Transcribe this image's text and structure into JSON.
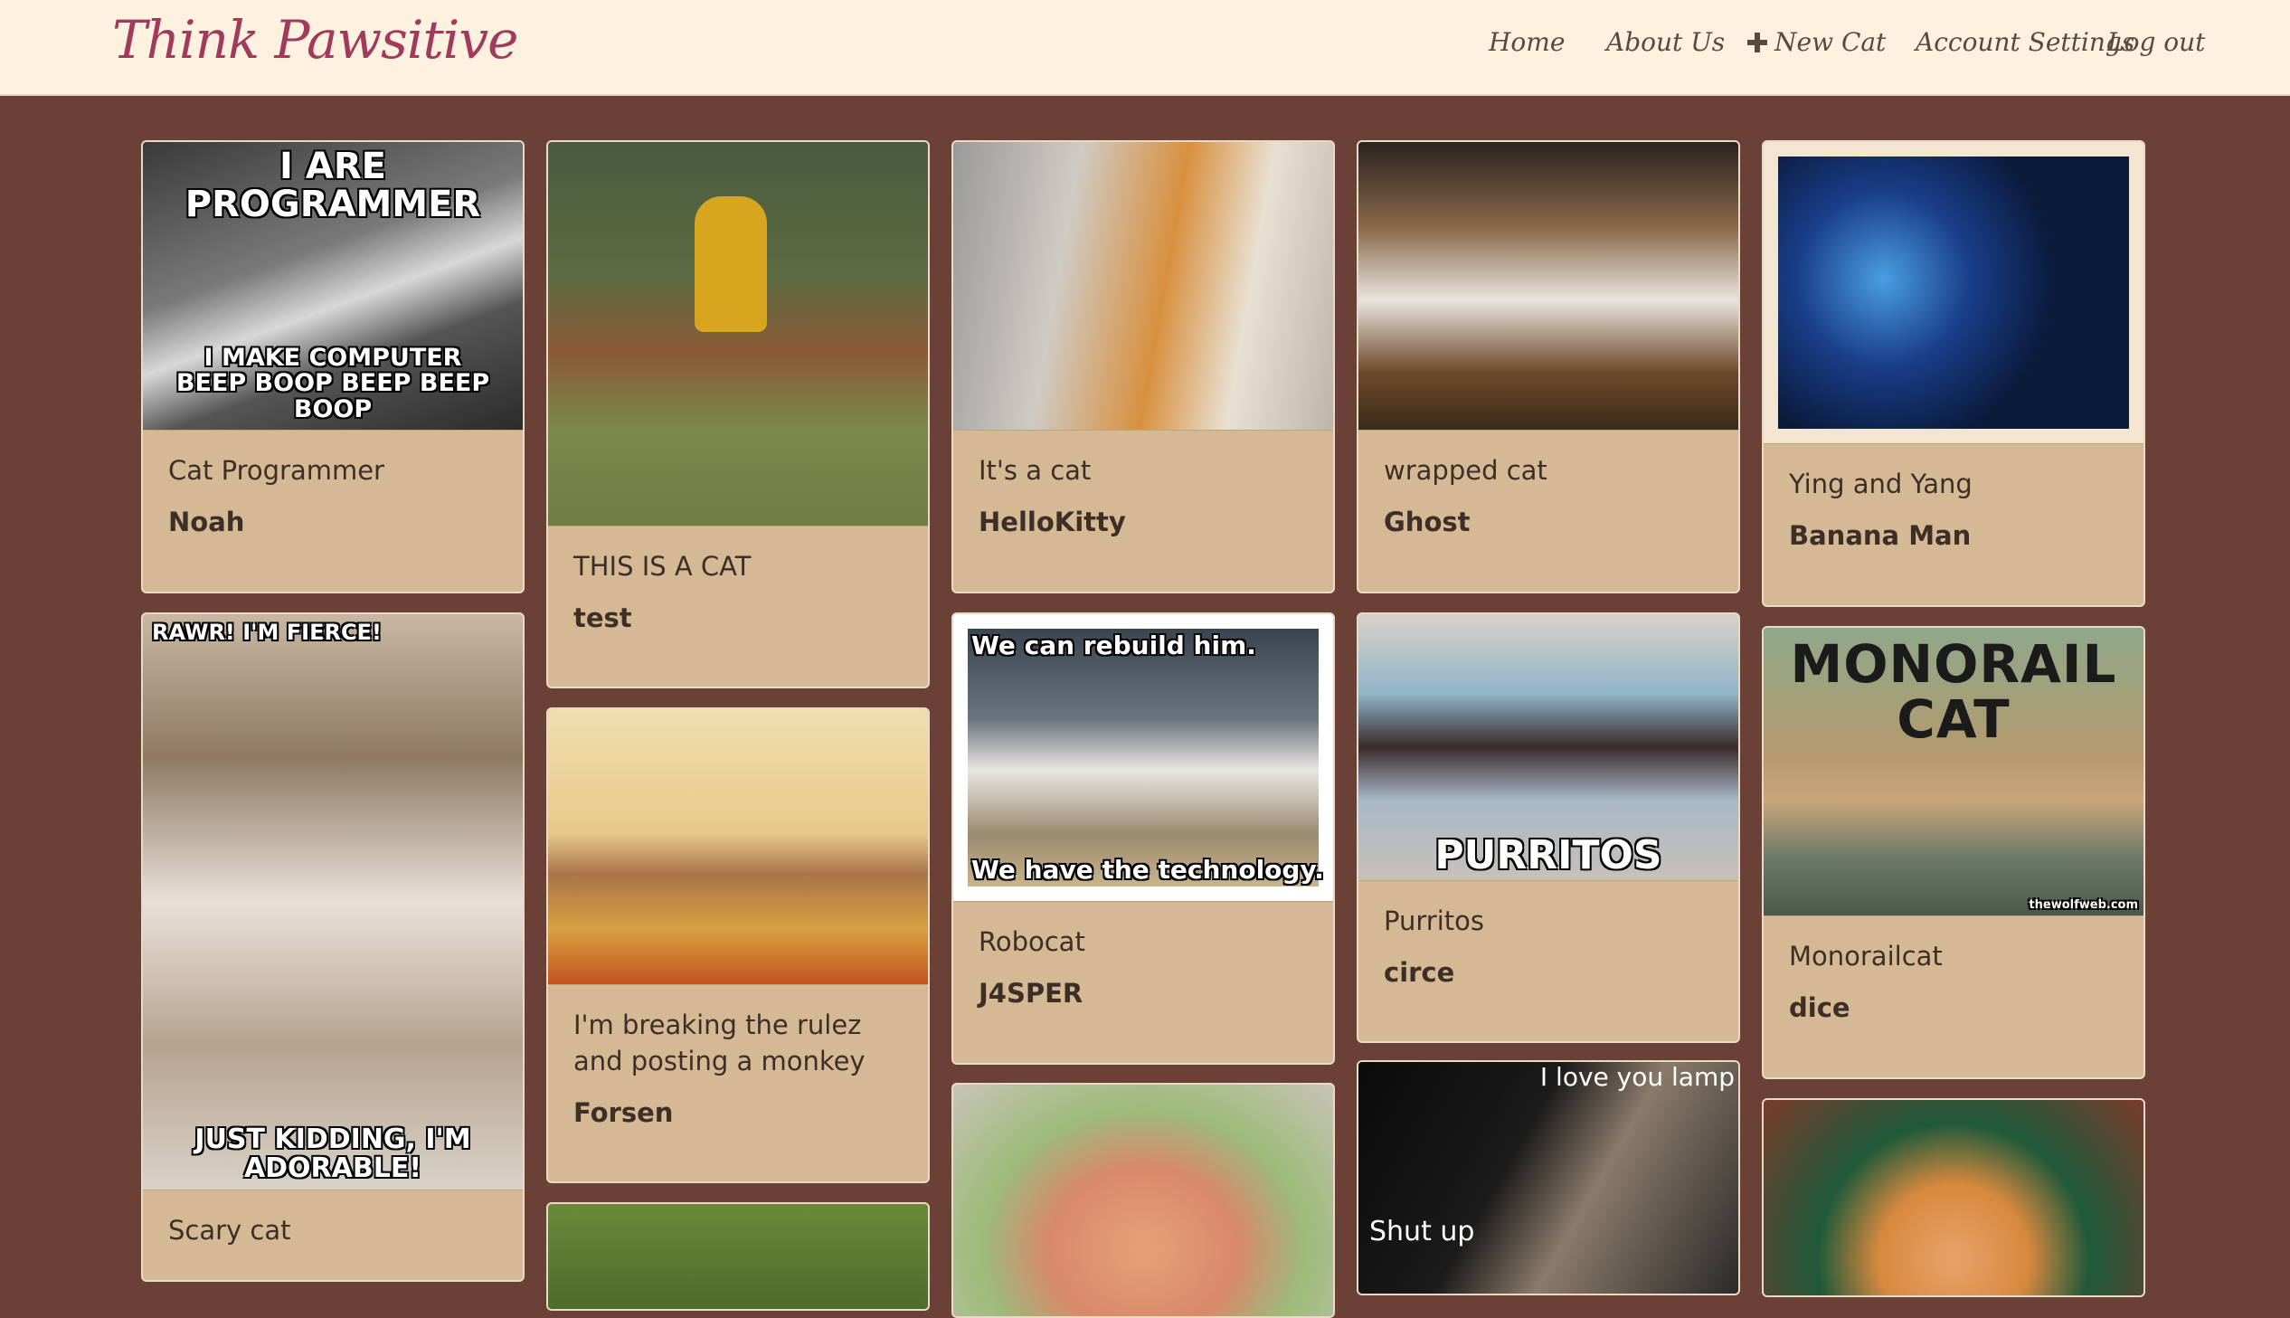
{
  "brand": "Think Pawsitive",
  "nav": {
    "home": "Home",
    "about": "About Us",
    "new_cat": "New Cat",
    "account": "Account Settings",
    "logout": "Log out"
  },
  "posts": {
    "p1": {
      "title": "Cat Programmer",
      "author": "Noah",
      "cap_top": "I ARE PROGRAMMER",
      "cap_bottom": "I MAKE COMPUTER BEEP BOOP BEEP BEEP BOOP"
    },
    "p2": {
      "title": "THIS IS A CAT",
      "author": "test"
    },
    "p3": {
      "title": "It's a cat",
      "author": "HelloKitty"
    },
    "p4": {
      "title": "wrapped cat",
      "author": "Ghost"
    },
    "p5": {
      "title": "Ying and Yang",
      "author": "Banana Man"
    },
    "p6": {
      "title": "Scary cat",
      "cap_top": "RAWR! I'M FIERCE!",
      "cap_bottom": "JUST KIDDING, I'M ADORABLE!"
    },
    "p7": {
      "title": "I'm breaking the rulez and posting a monkey",
      "author": "Forsen"
    },
    "p8": {
      "title": "Robocat",
      "author": "J4SPER",
      "cap_top": "We can rebuild him.",
      "cap_bottom": "We have the technology."
    },
    "p9": {
      "title": "Purritos",
      "author": "circe",
      "cap_bottom": "PURRITOS"
    },
    "p10": {
      "title": "Monorailcat",
      "author": "dice",
      "cap_top": "MONORAIL CAT",
      "credit": "thewolfweb.com"
    },
    "p11": {
      "cap_top": "I love you lamp",
      "cap_bottom": "Shut up"
    }
  },
  "colors": {
    "background": "#6b4037",
    "card": "#d4b994",
    "header": "#fdf1e0",
    "brand": "#a23a5c"
  }
}
